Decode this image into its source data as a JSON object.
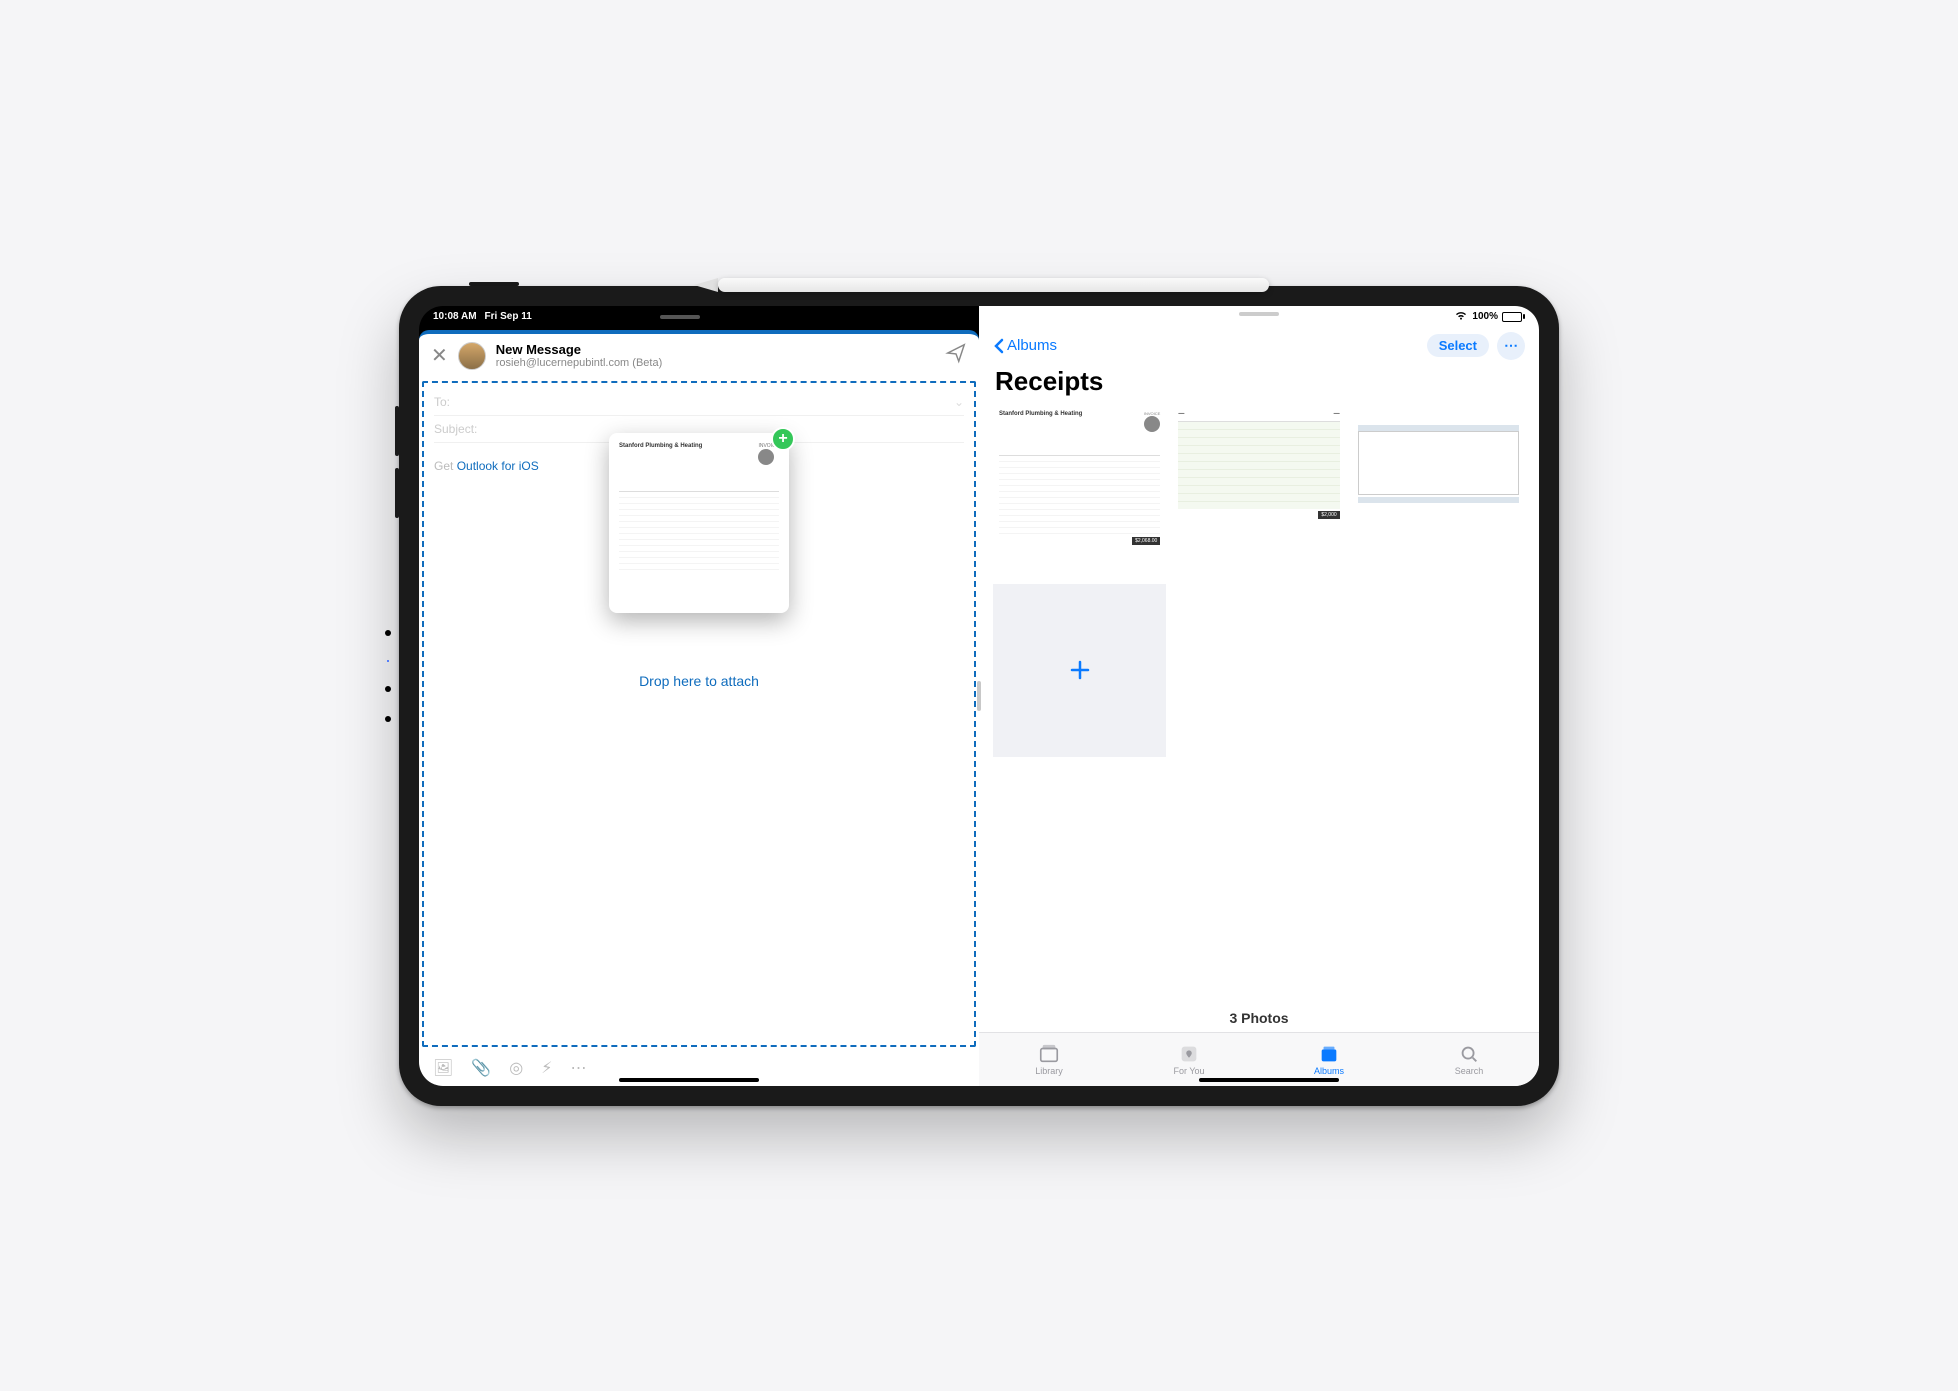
{
  "status": {
    "time": "10:08 AM",
    "date": "Fri Sep 11",
    "battery": "100%",
    "wifi_icon": "wifi"
  },
  "mail": {
    "title": "New Message",
    "from": "rosieh@lucernepubintl.com (Beta)",
    "to_label": "To:",
    "subject_label": "Subject:",
    "body_prefix": "Get ",
    "body_link": "Outlook for iOS",
    "drop_hint": "Drop here to attach",
    "drag_preview_title": "Stanford Plumbing & Heating",
    "drag_preview_tag": "INVOICE"
  },
  "photos": {
    "back_label": "Albums",
    "select_label": "Select",
    "album_title": "Receipts",
    "count": "3 Photos",
    "tiles": [
      {
        "name": "receipt-stanford",
        "heading": "Stanford Plumbing & Heating",
        "tag": "INVOICE",
        "total": "$2,068.00"
      },
      {
        "name": "receipt-green",
        "heading": "",
        "tag": "",
        "total": "$2,000"
      },
      {
        "name": "receipt-table",
        "heading": "",
        "tag": "",
        "total": ""
      }
    ],
    "tabs": [
      {
        "id": "library",
        "label": "Library",
        "active": false
      },
      {
        "id": "foryou",
        "label": "For You",
        "active": false
      },
      {
        "id": "albums",
        "label": "Albums",
        "active": true
      },
      {
        "id": "search",
        "label": "Search",
        "active": false
      }
    ]
  }
}
